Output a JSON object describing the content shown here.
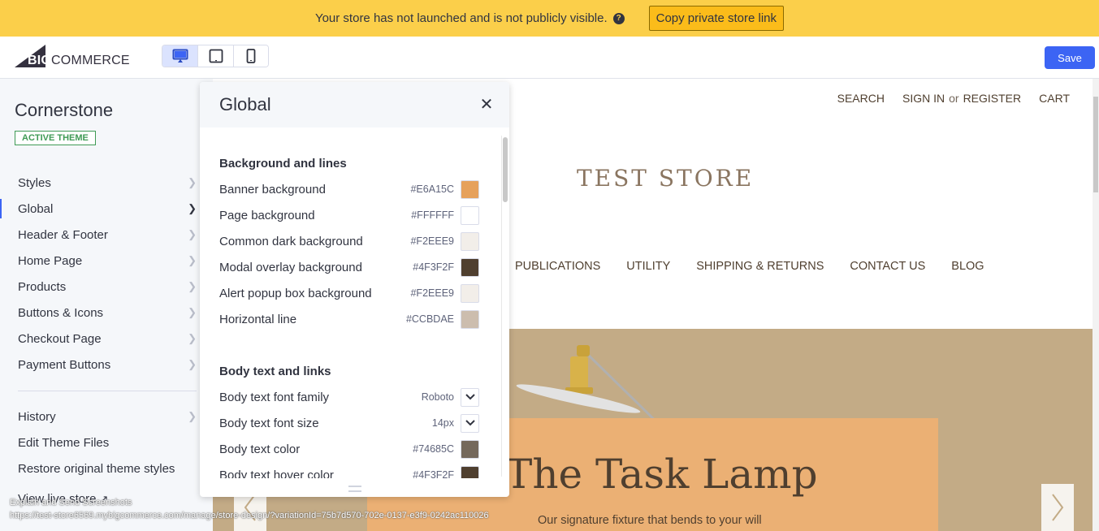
{
  "banner": {
    "message": "Your store has not launched and is not publicly visible.",
    "help_icon": "question-circle-icon",
    "copy_link_label": "Copy private store link"
  },
  "topbar": {
    "logo_big": "BIG",
    "logo_rest": "COMMERCE",
    "devices": [
      {
        "name": "desktop",
        "icon": "desktop-icon",
        "active": true
      },
      {
        "name": "tablet",
        "icon": "tablet-icon",
        "active": false
      },
      {
        "name": "mobile",
        "icon": "mobile-icon",
        "active": false
      }
    ],
    "save_label": "Save",
    "accent_color": "#3C64F4"
  },
  "sidebar": {
    "theme_name": "Cornerstone",
    "theme_badge": "ACTIVE THEME",
    "items": [
      {
        "label": "Styles"
      },
      {
        "label": "Global",
        "active": true
      },
      {
        "label": "Header & Footer"
      },
      {
        "label": "Home Page"
      },
      {
        "label": "Products"
      },
      {
        "label": "Buttons & Icons"
      },
      {
        "label": "Checkout Page"
      },
      {
        "label": "Payment Buttons"
      }
    ],
    "secondary": [
      {
        "label": "History"
      },
      {
        "label": "Edit Theme Files"
      },
      {
        "label": "Restore original theme styles"
      }
    ],
    "view_live": "View live store"
  },
  "panel": {
    "title": "Global",
    "sections": [
      {
        "title": "Background and lines",
        "rows": [
          {
            "label": "Banner background",
            "value": "#E6A15C",
            "color": "#E6A15C"
          },
          {
            "label": "Page background",
            "value": "#FFFFFF",
            "color": "#FFFFFF"
          },
          {
            "label": "Common dark background",
            "value": "#F2EEE9",
            "color": "#F2EEE9"
          },
          {
            "label": "Modal overlay background",
            "value": "#4F3F2F",
            "color": "#4F3F2F"
          },
          {
            "label": "Alert popup box background",
            "value": "#F2EEE9",
            "color": "#F2EEE9"
          },
          {
            "label": "Horizontal line",
            "value": "#CCBDAE",
            "color": "#CCBDAE"
          }
        ]
      },
      {
        "title": "Body text and links",
        "rows": [
          {
            "label": "Body text font family",
            "value": "Roboto",
            "type": "select"
          },
          {
            "label": "Body text font size",
            "value": "14px",
            "type": "select"
          },
          {
            "label": "Body text color",
            "value": "#74685C",
            "color": "#74685C"
          },
          {
            "label": "Body text hover color",
            "value": "#4F3F2F",
            "color": "#4F3F2F"
          }
        ]
      }
    ]
  },
  "preview": {
    "header_links": {
      "search": "SEARCH",
      "sign_in": "SIGN IN",
      "or": "or",
      "register": "REGISTER",
      "cart": "CART"
    },
    "store_title": "TEST STORE",
    "nav": [
      "PUBLICATIONS",
      "UTILITY",
      "SHIPPING & RETURNS",
      "CONTACT US",
      "BLOG"
    ],
    "hero_title": "The Task Lamp",
    "hero_subtitle": "Our signature fixture that bends to your will"
  },
  "overlay": {
    "line1": "Explain and Send Screenshots",
    "line2": "https://test-store6569.mybigcommerce.com/manage/store-design/?variationId=75b7d570-702e-0137-e3f9-0242ac110026"
  }
}
